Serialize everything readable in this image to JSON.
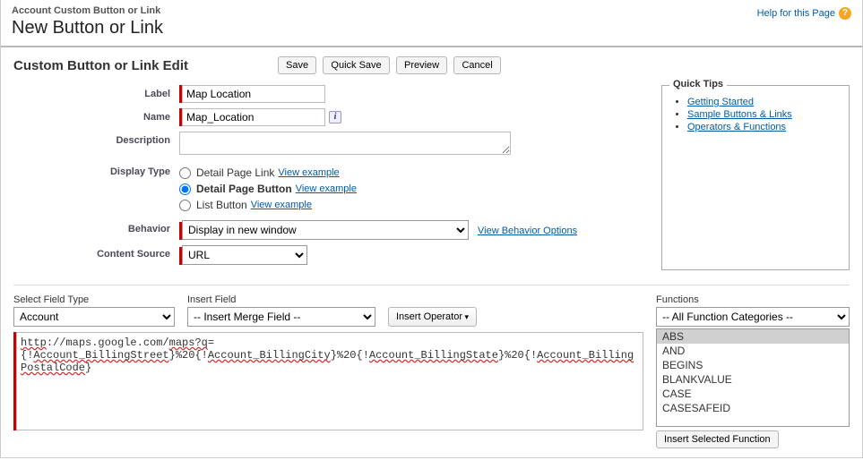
{
  "header": {
    "breadcrumb": "Account Custom Button or Link",
    "title": "New Button or Link",
    "help_text": "Help for this Page",
    "help_icon": "?"
  },
  "section": {
    "title": "Custom Button or Link Edit",
    "buttons": {
      "save": "Save",
      "quick_save": "Quick Save",
      "preview": "Preview",
      "cancel": "Cancel"
    }
  },
  "fields": {
    "label": {
      "label": "Label",
      "value": "Map Location"
    },
    "name": {
      "label": "Name",
      "value": "Map_Location"
    },
    "description": {
      "label": "Description",
      "value": ""
    },
    "display_type": {
      "label": "Display Type",
      "options": [
        {
          "label": "Detail Page Link",
          "selected": false
        },
        {
          "label": "Detail Page Button",
          "selected": true
        },
        {
          "label": "List Button",
          "selected": false
        }
      ],
      "view_example": "View example"
    },
    "behavior": {
      "label": "Behavior",
      "value": "Display in new window",
      "view_options": "View Behavior Options"
    },
    "content_source": {
      "label": "Content Source",
      "value": "URL"
    }
  },
  "tips": {
    "legend": "Quick Tips",
    "items": [
      "Getting Started",
      "Sample Buttons & Links",
      "Operators & Functions"
    ]
  },
  "editor": {
    "field_type": {
      "label": "Select Field Type",
      "value": "Account"
    },
    "insert_field": {
      "label": "Insert Field",
      "value": "-- Insert Merge Field --"
    },
    "insert_operator": "Insert Operator",
    "formula": "http://maps.google.com/maps?q={!Account_BillingStreet}%20{!Account_BillingCity}%20{!Account_BillingState}%20{!Account_BillingPostalCode}",
    "functions": {
      "label": "Functions",
      "category": "-- All Function Categories --",
      "list": [
        "ABS",
        "AND",
        "BEGINS",
        "BLANKVALUE",
        "CASE",
        "CASESAFEID"
      ],
      "selected": "ABS",
      "insert_btn": "Insert Selected Function"
    }
  }
}
